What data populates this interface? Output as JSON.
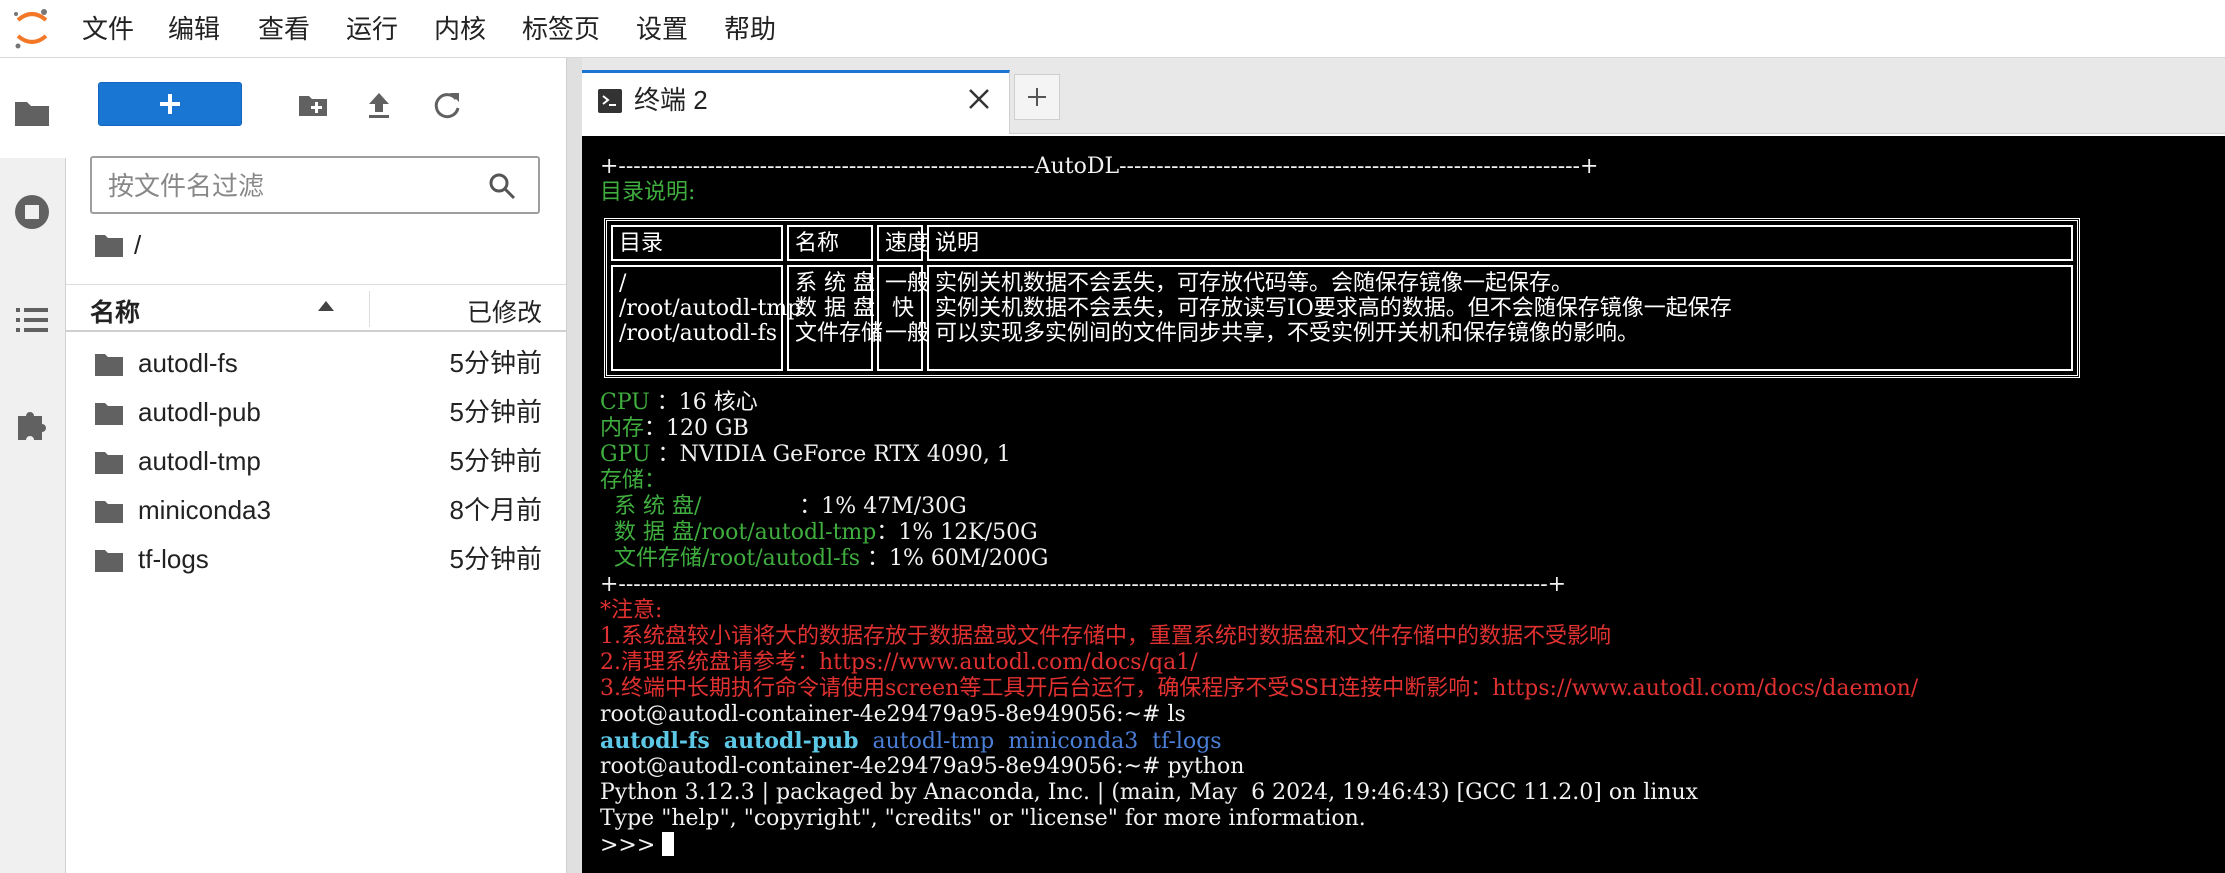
{
  "menu": {
    "items": [
      "文件",
      "编辑",
      "查看",
      "运行",
      "内核",
      "标签页",
      "设置",
      "帮助"
    ]
  },
  "sidebar": {
    "icons": [
      "folder-icon",
      "stop-circle-icon",
      "list-icon",
      "puzzle-icon"
    ]
  },
  "filebrowser": {
    "new_button_label": "+",
    "toolbar_icons": [
      "new-folder-icon",
      "upload-icon",
      "refresh-icon"
    ],
    "search_placeholder": "按文件名过滤",
    "breadcrumb": "/",
    "columns": {
      "name": "名称",
      "modified": "已修改"
    },
    "files": [
      {
        "name": "autodl-fs",
        "modified": "5分钟前"
      },
      {
        "name": "autodl-pub",
        "modified": "5分钟前"
      },
      {
        "name": "autodl-tmp",
        "modified": "5分钟前"
      },
      {
        "name": "miniconda3",
        "modified": "8个月前"
      },
      {
        "name": "tf-logs",
        "modified": "5分钟前"
      }
    ]
  },
  "tabs": {
    "active_label": "终端 2",
    "add_label": "+"
  },
  "terminal": {
    "banner_top": "+--------------------------------------------------------AutoDL--------------------------------------------------------------+",
    "dir_title": "目录说明:",
    "table": {
      "headers": [
        "目录",
        "名称",
        "速度",
        "说明"
      ],
      "dirs": "/\n/root/autodl-tmp\n/root/autodl-fs",
      "names": "系 统 盘\n数 据 盘\n文件存储",
      "speeds": "一般\n 快 \n一般",
      "descs": "实例关机数据不会丢失，可存放代码等。会随保存镜像一起保存。\n实例关机数据不会丢失，可存放读写IO要求高的数据。但不会随保存镜像一起保存\n可以实现多实例间的文件同步共享，不受实例开关机和保存镜像的影响。"
    },
    "cpu_label": "CPU",
    "cpu_value": "：16 核心",
    "mem_label": "内存",
    "mem_value": "：120 GB",
    "gpu_label": "GPU",
    "gpu_value": "：NVIDIA GeForce RTX 4090, 1",
    "storage_label": "存储：",
    "storage": [
      {
        "label": "  系 统 盘/              ",
        "value": "：1% 47M/30G"
      },
      {
        "label": "  数 据 盘/root/autodl-tmp",
        "value": "：1% 12K/50G"
      },
      {
        "label": "  文件存储/root/autodl-fs ",
        "value": "：1% 60M/200G"
      }
    ],
    "banner_bottom": "+-----------------------------------------------------------------------------------------------------------------------------+",
    "notes": [
      "*注意:",
      "1.系统盘较小请将大的数据存放于数据盘或文件存储中，重置系统时数据盘和文件存储中的数据不受影响",
      "2.清理系统盘请参考：https://www.autodl.com/docs/qa1/",
      "3.终端中长期执行命令请使用screen等工具开后台运行，确保程序不受SSH连接中断影响：https://www.autodl.com/docs/daemon/"
    ],
    "prompt1": "root@autodl-container-4e29479a95-8e949056:~# ls",
    "ls_items": [
      "autodl-fs",
      "autodl-pub",
      "autodl-tmp",
      "miniconda3",
      "tf-logs"
    ],
    "prompt2": "root@autodl-container-4e29479a95-8e949056:~# python",
    "py1": "Python 3.12.3 | packaged by Anaconda, Inc. | (main, May  6 2024, 19:46:43) [GCC 11.2.0] on linux",
    "py2": "Type \"help\", \"copyright\", \"credits\" or \"license\" for more information.",
    "py_prompt": ">>> "
  },
  "colors": {
    "accent": "#1976d2",
    "terminal_bg": "#000000",
    "terminal_green": "#3fae3f",
    "terminal_red": "#e03131",
    "ls_dir_cyan": "#5cc8e6",
    "ls_dir_blue": "#4a7fd8"
  }
}
